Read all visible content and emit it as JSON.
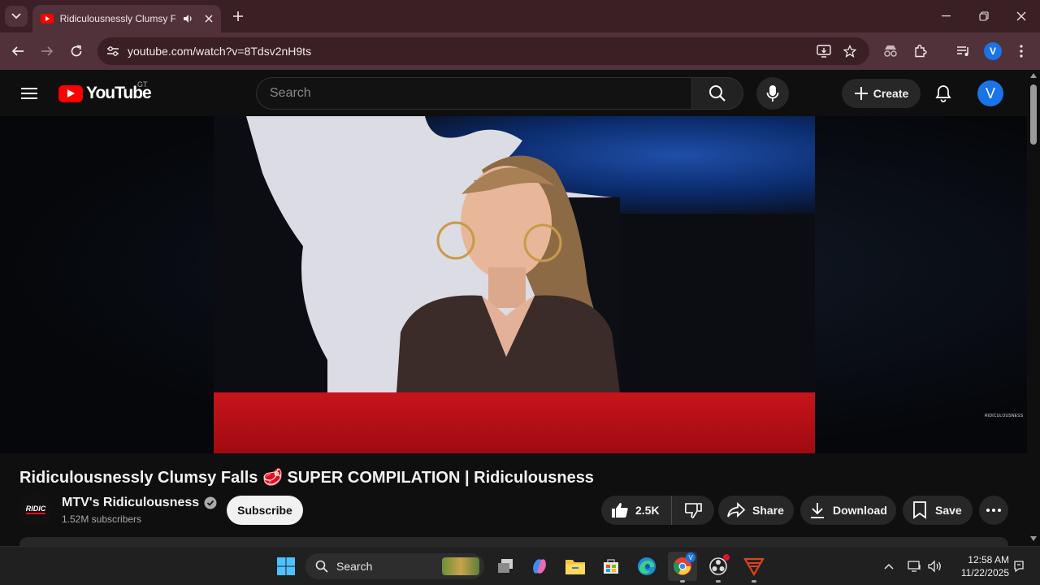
{
  "browser": {
    "tab_title": "Ridiculousnessly Clumsy Falls",
    "url": "youtube.com/watch?v=8Tdsv2nH9ts",
    "profile_initial": "V"
  },
  "youtube": {
    "logo_text": "YouTube",
    "country_code": "GT",
    "search_placeholder": "Search",
    "create_label": "Create",
    "avatar_initial": "V"
  },
  "video": {
    "title": "Ridiculousnessly Clumsy Falls 🥩 SUPER COMPILATION | Ridiculousness",
    "watermark": "RIDICULOUSNESS",
    "channel": {
      "name": "MTV's Ridiculousness",
      "subscribers": "1.52M subscribers",
      "avatar_text": "RIDIC",
      "verified": true
    },
    "actions": {
      "subscribe": "Subscribe",
      "likes": "2.5K",
      "share": "Share",
      "download": "Download",
      "save": "Save"
    }
  },
  "taskbar": {
    "search_label": "Search",
    "time": "12:58 AM",
    "date": "11/22/2025"
  },
  "colors": {
    "browser_frame": "#3a1f24",
    "browser_toolbar": "#51323a",
    "yt_bg": "#0f0f0f",
    "yt_red": "#ff0000",
    "pill_bg": "#272727",
    "taskbar_bg": "#202020"
  }
}
